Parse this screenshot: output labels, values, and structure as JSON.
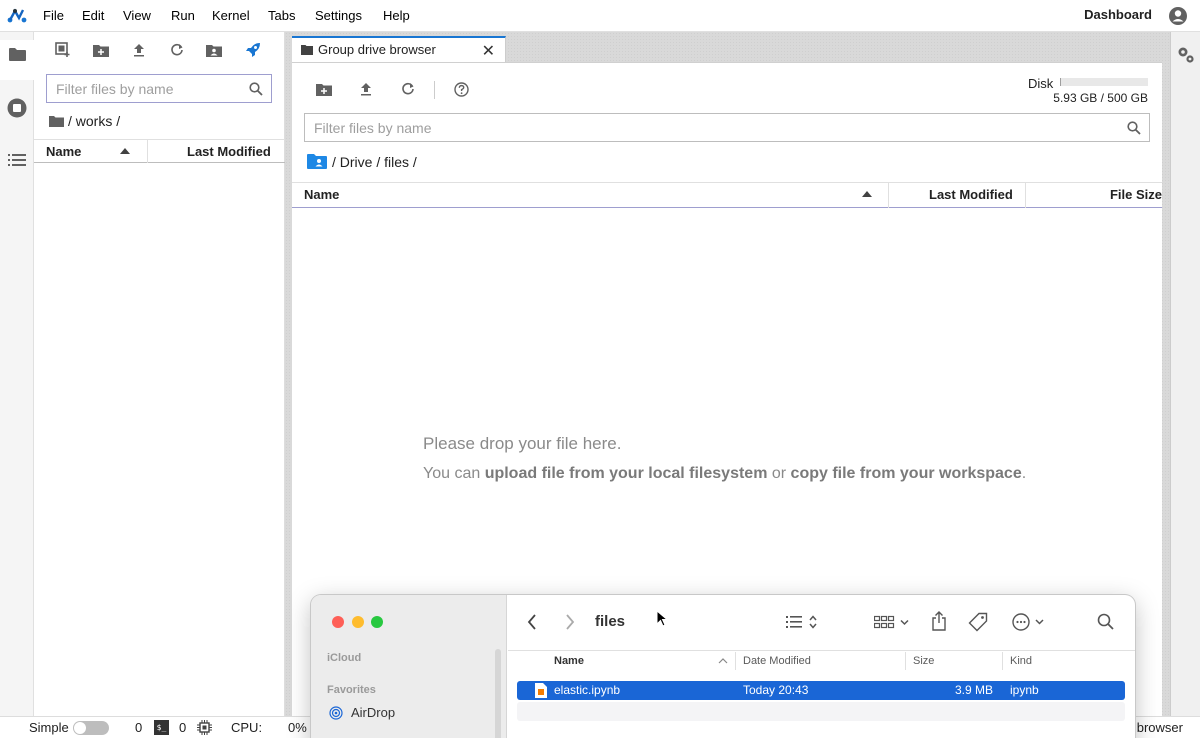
{
  "menubar": {
    "items": [
      "File",
      "Edit",
      "View",
      "Run",
      "Kernel",
      "Tabs",
      "Settings",
      "Help"
    ],
    "dashboard": "Dashboard"
  },
  "activity": {
    "icons": [
      "folder-icon",
      "running-icon",
      "toc-icon"
    ]
  },
  "side": {
    "filter_placeholder": "Filter files by name",
    "path": "/ works /",
    "col_name": "Name",
    "col_modified": "Last Modified"
  },
  "main": {
    "tab_title": "Group drive browser",
    "disk_label": "Disk",
    "disk_usage": "5.93 GB / 500 GB",
    "disk_fraction": 0.012,
    "filter_placeholder": "Filter files by name",
    "breadcrumb": "/ Drive / files /",
    "col_name": "Name",
    "col_modified": "Last Modified",
    "col_size": "File Size",
    "drop_title": "Please drop your file here.",
    "drop_pre": "You can ",
    "drop_b1": "upload file from your local filesystem",
    "drop_mid": " or ",
    "drop_b2": "copy file from your workspace",
    "drop_end": "."
  },
  "status": {
    "mode": "Simple",
    "terminals": "0",
    "kernels": "0",
    "cpu": "CPU:",
    "cpu_value": "0%",
    "right_text": "browser"
  },
  "finder": {
    "folder": "files",
    "sidebar_icloud": "iCloud",
    "sidebar_favorites": "Favorites",
    "airdrop": "AirDrop",
    "col_name": "Name",
    "col_date": "Date Modified",
    "col_size": "Size",
    "col_kind": "Kind",
    "file": {
      "name": "elastic.ipynb",
      "date": "Today 20:43",
      "size": "3.9 MB",
      "kind": "ipynb"
    }
  },
  "colors": {
    "accent": "#1976d2",
    "selection": "#1a66d6",
    "disk_bar": "#e0e0e0"
  }
}
